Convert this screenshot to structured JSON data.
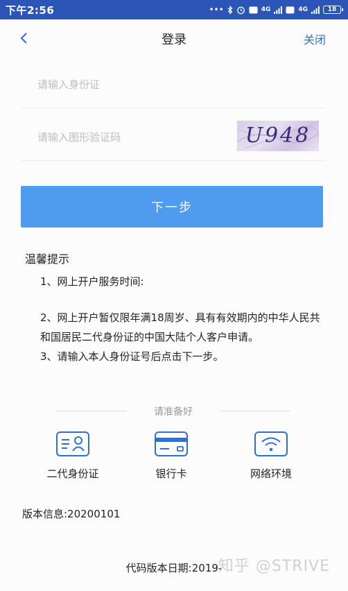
{
  "status_bar": {
    "time": "下午2:56",
    "signal_1": "4G",
    "signal_2": "4G",
    "battery": "18"
  },
  "nav": {
    "title": "登录",
    "close_label": "关闭"
  },
  "form": {
    "id_placeholder": "请输入身份证",
    "captcha_placeholder": "请输入图形验证码",
    "captcha_text": "U948",
    "next_label": "下一步"
  },
  "tips": {
    "title": "温馨提示",
    "items": [
      "1、网上开户服务时间:",
      "2、网上开户暂仅限年满18周岁、具有有效期内的中华人民共和国居民二代身份证的中国大陆个人客户申请。",
      "3、请输入本人身份证号后点击下一步。"
    ]
  },
  "prepare": {
    "title": "请准备好",
    "items": [
      {
        "label": "二代身份证",
        "icon": "id-card-icon"
      },
      {
        "label": "银行卡",
        "icon": "bank-card-icon"
      },
      {
        "label": "网络环境",
        "icon": "wifi-icon"
      }
    ]
  },
  "footer": {
    "version": "版本信息:20200101",
    "code_date": "代码版本日期:2019-",
    "watermark": "知乎 @STRIVE"
  },
  "colors": {
    "status_bar": "#2c55b8",
    "accent": "#2d6fd6",
    "button": "#4e9bf0"
  }
}
